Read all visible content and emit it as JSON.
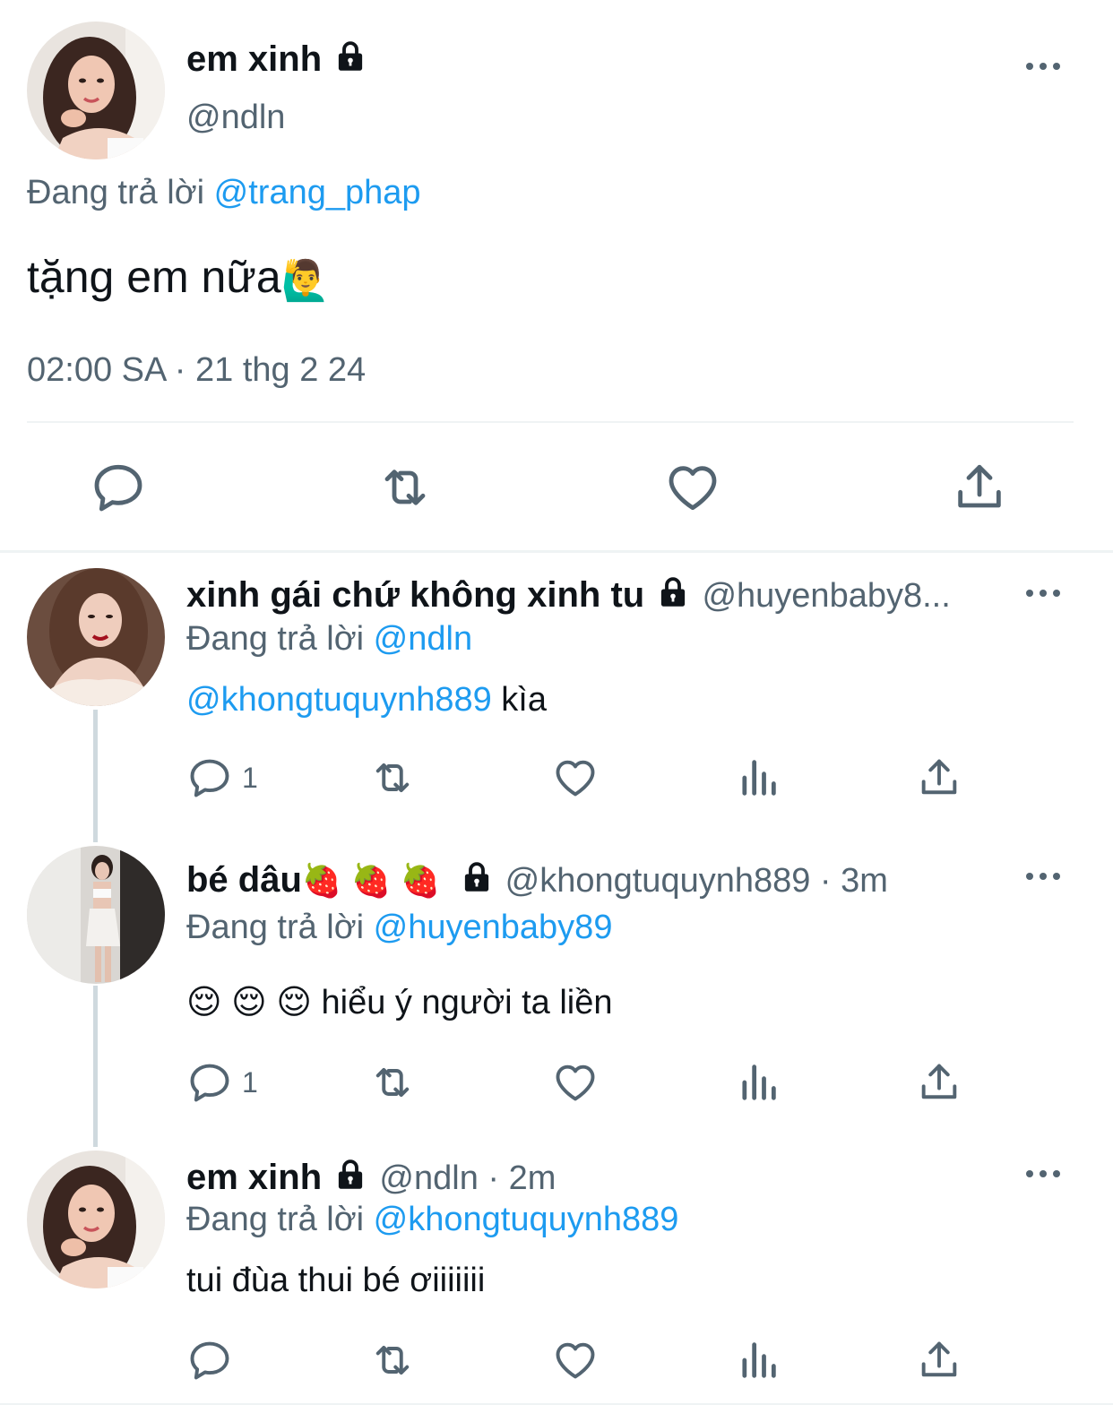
{
  "main_tweet": {
    "display_name": "em xinh",
    "handle": "@ndln",
    "replying_to_prefix": "Đang trả lời",
    "replying_to": "@trang_phap",
    "text": "tặng em nữa",
    "emoji": "🙋‍♂️",
    "timestamp": "02:00 SA · 21 thg 2 24"
  },
  "replies": [
    {
      "display_name": "xinh gái chứ không xinh tu",
      "handle": "@huyenbaby8...",
      "replying_to_prefix": "Đang trả lời",
      "replying_to": "@ndln",
      "mention": "@khongtuquynh889",
      "text": " kìa",
      "reply_count": "1"
    },
    {
      "display_name": "bé dâu",
      "name_emoji": "🍓 🍓 🍓",
      "handle": "@khongtuquynh889 · 3m",
      "replying_to_prefix": "Đang trả lời",
      "replying_to": "@huyenbaby89",
      "text_emoji": "😌 😌 😌",
      "text": " hiểu ý người ta liền",
      "reply_count": "1"
    },
    {
      "display_name": "em xinh",
      "handle": "@ndln · 2m",
      "replying_to_prefix": "Đang trả lời",
      "replying_to": "@khongtuquynh889",
      "text": "tui đùa thui bé ơiiiiiii",
      "reply_count": ""
    }
  ],
  "icons": [
    "reply-icon",
    "retweet-icon",
    "like-icon",
    "views-icon",
    "share-icon",
    "lock-icon",
    "more-icon"
  ],
  "colors": {
    "link": "#1d9bf0",
    "secondary": "#536471",
    "text": "#0f1419",
    "thread_line": "#cfd9de"
  }
}
